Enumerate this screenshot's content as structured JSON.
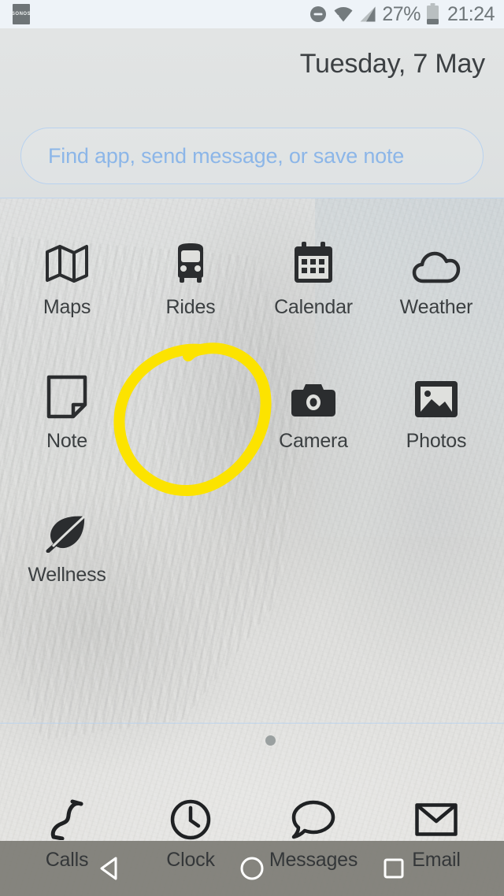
{
  "status_bar": {
    "notification_icon": "sonos-app-icon",
    "notification_label": "SONOS",
    "dnd_icon": "do-not-disturb-icon",
    "wifi_icon": "wifi-icon",
    "signal_icon": "cellular-signal-icon",
    "battery_percent": "27%",
    "battery_icon": "battery-icon",
    "battery_level": 27,
    "time": "21:24"
  },
  "header": {
    "date": "Tuesday, 7 May"
  },
  "search": {
    "placeholder": "Find app, send message, or save note",
    "value": "",
    "accent_color": "#8cb6e8"
  },
  "apps": [
    [
      {
        "label": "Maps",
        "icon": "map-icon"
      },
      {
        "label": "Rides",
        "icon": "bus-icon"
      },
      {
        "label": "Calendar",
        "icon": "calendar-icon"
      },
      {
        "label": "Weather",
        "icon": "cloud-icon"
      }
    ],
    [
      {
        "label": "Note",
        "icon": "note-icon"
      },
      {
        "label": "",
        "icon": "empty-slot"
      },
      {
        "label": "Camera",
        "icon": "camera-icon"
      },
      {
        "label": "Photos",
        "icon": "photos-icon"
      }
    ],
    [
      {
        "label": "Wellness",
        "icon": "leaf-icon"
      },
      {
        "label": "",
        "icon": "empty-slot"
      },
      {
        "label": "",
        "icon": "empty-slot"
      },
      {
        "label": "",
        "icon": "empty-slot"
      }
    ]
  ],
  "annotation": {
    "shape": "hand-drawn-circle",
    "color": "#FCE300",
    "target": "empty-app-slot-row2-col2"
  },
  "page_indicator": {
    "pages": 1,
    "current": 1
  },
  "dock": [
    {
      "label": "Calls",
      "icon": "phone-icon"
    },
    {
      "label": "Clock",
      "icon": "clock-icon"
    },
    {
      "label": "Messages",
      "icon": "chat-bubble-icon"
    },
    {
      "label": "Email",
      "icon": "envelope-icon"
    }
  ],
  "navigation_bar": {
    "back": "back-triangle-icon",
    "home": "home-circle-icon",
    "recents": "recents-square-icon"
  }
}
